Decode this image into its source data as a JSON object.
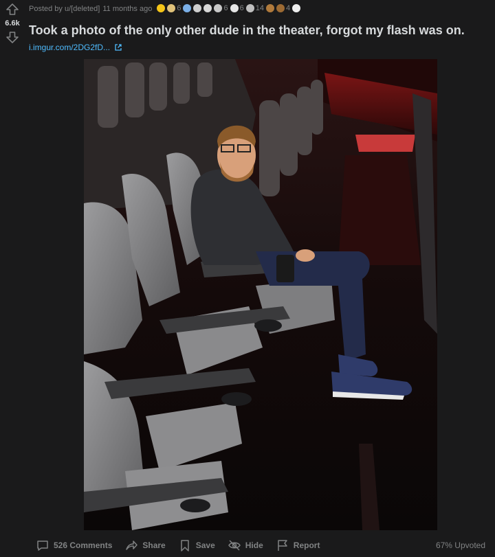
{
  "post": {
    "score": "6.6k",
    "posted_by": "Posted by u/[deleted]",
    "time": "11 months ago",
    "title": "Took a photo of the only other dude in the theater, forgot my flash was on.",
    "link": "i.imgur.com/2DG2fD...",
    "awards": [
      {
        "icon": "award-gold-icon",
        "color": "#f5c518",
        "count": ""
      },
      {
        "icon": "award-wholesome-icon",
        "color": "#e0c27a",
        "count": "6"
      },
      {
        "icon": "award-eyes-icon",
        "color": "#7bb0e8",
        "count": ""
      },
      {
        "icon": "award-skull-icon",
        "color": "#cfcfcf",
        "count": ""
      },
      {
        "icon": "award-party-icon",
        "color": "#d8d8d8",
        "count": ""
      },
      {
        "icon": "award-helpful-icon",
        "color": "#c9c9c9",
        "count": "6"
      },
      {
        "icon": "award-bubble-icon",
        "color": "#e6e6e6",
        "count": "6"
      },
      {
        "icon": "award-coin-icon",
        "color": "#bfbfbf",
        "count": "14"
      },
      {
        "icon": "award-poop-icon",
        "color": "#b07a3c",
        "count": ""
      },
      {
        "icon": "award-poop2-icon",
        "color": "#9c6a33",
        "count": "4"
      },
      {
        "icon": "award-wow-icon",
        "color": "#eeeeee",
        "count": ""
      }
    ]
  },
  "actions": {
    "comments": "526 Comments",
    "share": "Share",
    "save": "Save",
    "hide": "Hide",
    "report": "Report",
    "upvoted": "67% Upvoted"
  }
}
